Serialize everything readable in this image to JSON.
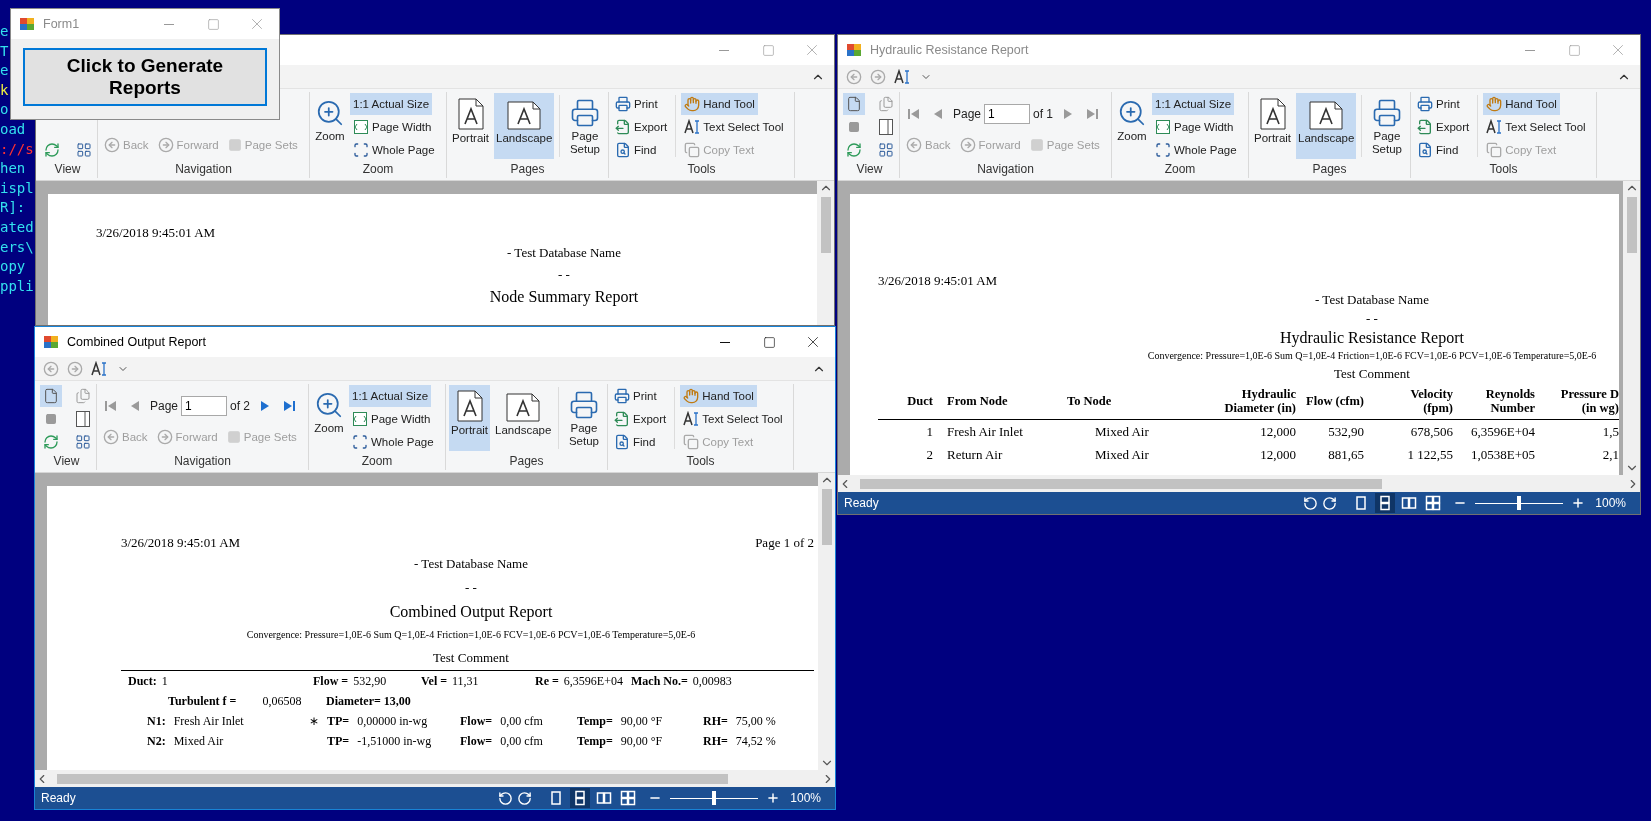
{
  "console": {
    "lines": [
      {
        "text": "e",
        "color": "#33e0ee"
      },
      {
        "text": "T",
        "color": "#33e0ee"
      },
      {
        "text": "e",
        "color": "#33e0ee"
      },
      {
        "text": "k",
        "color": "#f0f040"
      },
      {
        "text": "o",
        "color": "#33e0ee"
      },
      {
        "text": "oad",
        "color": "#33e0ee"
      },
      {
        "text": "://s",
        "color": "#ff3030"
      },
      {
        "text": "hen",
        "color": "#33e0ee"
      },
      {
        "text": "ispl",
        "color": "#33e0ee"
      },
      {
        "text": "R]:",
        "color": "#33e0ee"
      },
      {
        "text": "ated",
        "color": "#33e0ee"
      },
      {
        "text": "ers\\",
        "color": "#33e0ee"
      },
      {
        "text": "opy",
        "color": "#33e0ee"
      },
      {
        "text": "ppli",
        "color": "#33e0ee"
      }
    ]
  },
  "form1": {
    "title": "Form1",
    "active": false,
    "button": "Click to Generate Reports"
  },
  "report_windows": [
    {
      "active": false,
      "ribbon": {
        "groups": [
          {
            "kind": "view",
            "label": "View"
          },
          {
            "kind": "navigation",
            "label": "Navigation",
            "history": [
              {
                "label": "Back",
                "disabled": true
              },
              {
                "label": "Forward",
                "disabled": true
              },
              {
                "label": "Page Sets",
                "disabled": true
              }
            ]
          },
          {
            "kind": "zoom",
            "label": "Zoom",
            "button": "Zoom",
            "options": [
              {
                "label": "1:1 Actual Size",
                "selected": true
              },
              {
                "label": "Page Width",
                "selected": false
              },
              {
                "label": "Whole Page",
                "selected": false
              }
            ]
          },
          {
            "kind": "pages",
            "label": "Pages",
            "orientations": [
              {
                "label": "Portrait",
                "selected": false
              },
              {
                "label": "Landscape",
                "selected": true
              }
            ],
            "setup": "Page Setup"
          },
          {
            "kind": "tools",
            "label": "Tools",
            "actions": [
              {
                "label": "Print"
              },
              {
                "label": "Export"
              },
              {
                "label": "Find"
              }
            ],
            "tools": [
              {
                "label": "Hand Tool",
                "selected": true,
                "disabled": false
              },
              {
                "label": "Text Select Tool",
                "selected": false,
                "disabled": false
              },
              {
                "label": "Copy Text",
                "selected": false,
                "disabled": true
              }
            ]
          }
        ]
      },
      "document": {
        "date": "3/26/2018 9:45:01 AM",
        "lines": [
          {
            "kind": "subtitle",
            "text": "- Test Database Name"
          },
          {
            "kind": "subtitle",
            "text": "- -"
          },
          {
            "kind": "title",
            "text": "Node Summary Report"
          }
        ]
      }
    },
    {
      "active": false,
      "title": "Hydraulic Resistance Report",
      "quick_access": {
        "back_enabled": false,
        "forward_enabled": false
      },
      "ribbon": {
        "groups": [
          {
            "kind": "view",
            "label": "View",
            "single_page_selected": true
          },
          {
            "kind": "navigation",
            "label": "Navigation",
            "page_nav": {
              "label": "Page",
              "value": "1",
              "total": "of 1",
              "first_enabled": false,
              "prev_enabled": false,
              "next_enabled": false,
              "last_enabled": false
            },
            "history": [
              {
                "label": "Back",
                "disabled": true
              },
              {
                "label": "Forward",
                "disabled": true
              },
              {
                "label": "Page Sets",
                "disabled": true
              }
            ]
          },
          {
            "kind": "zoom",
            "label": "Zoom",
            "button": "Zoom",
            "options": [
              {
                "label": "1:1 Actual Size",
                "selected": true
              },
              {
                "label": "Page Width",
                "selected": false
              },
              {
                "label": "Whole Page",
                "selected": false
              }
            ]
          },
          {
            "kind": "pages",
            "label": "Pages",
            "orientations": [
              {
                "label": "Portrait",
                "selected": false
              },
              {
                "label": "Landscape",
                "selected": true
              }
            ],
            "setup": "Page Setup"
          },
          {
            "kind": "tools",
            "label": "Tools",
            "actions": [
              {
                "label": "Print"
              },
              {
                "label": "Export"
              },
              {
                "label": "Find"
              }
            ],
            "tools": [
              {
                "label": "Hand Tool",
                "selected": true,
                "disabled": false
              },
              {
                "label": "Text Select Tool",
                "selected": false,
                "disabled": false
              },
              {
                "label": "Copy Text",
                "selected": false,
                "disabled": true
              }
            ]
          }
        ]
      },
      "document": {
        "date": "3/26/2018 9:45:01 AM",
        "lines": [
          {
            "kind": "subtitle",
            "text": "- Test Database Name"
          },
          {
            "kind": "subtitle",
            "text": "- -"
          },
          {
            "kind": "title",
            "text": "Hydraulic Resistance Report"
          },
          {
            "kind": "note",
            "text": "Convergence: Pressure=1,0E-6 Sum Q=1,0E-4 Friction=1,0E-6 FCV=1,0E-6 PCV=1,0E-6 Temperature=5,0E-6"
          },
          {
            "kind": "subtitle",
            "text": "Test Comment"
          }
        ],
        "table": {
          "columns": [
            "Duct",
            "From Node",
            "To Node",
            "Hydraulic Diameter (in)",
            "Flow (cfm)",
            "Velocity (fpm)",
            "Reynolds Number",
            "Pressure D (in wg)"
          ],
          "rows": [
            [
              "1",
              "Fresh Air Inlet",
              "Mixed Air",
              "12,000",
              "532,90",
              "678,506",
              "6,3596E+04",
              "1,5"
            ],
            [
              "2",
              "Return Air",
              "Mixed Air",
              "12,000",
              "881,65",
              "1 122,55",
              "1,0538E+05",
              "2,1"
            ]
          ]
        }
      },
      "status": {
        "text": "Ready",
        "view_modes": [
          {
            "selected": false
          },
          {
            "selected": true
          },
          {
            "selected": false
          },
          {
            "selected": false
          }
        ],
        "zoom": {
          "level": 0.5,
          "reading": "100%"
        }
      }
    },
    {
      "active": true,
      "title": "Combined Output Report",
      "quick_access": {
        "back_enabled": false,
        "forward_enabled": false
      },
      "ribbon": {
        "groups": [
          {
            "kind": "view",
            "label": "View",
            "single_page_selected": true
          },
          {
            "kind": "navigation",
            "label": "Navigation",
            "page_nav": {
              "label": "Page",
              "value": "1",
              "total": "of 2",
              "first_enabled": false,
              "prev_enabled": false,
              "next_enabled": true,
              "last_enabled": true
            },
            "history": [
              {
                "label": "Back",
                "disabled": true
              },
              {
                "label": "Forward",
                "disabled": true
              },
              {
                "label": "Page Sets",
                "disabled": true
              }
            ]
          },
          {
            "kind": "zoom",
            "label": "Zoom",
            "button": "Zoom",
            "options": [
              {
                "label": "1:1 Actual Size",
                "selected": true
              },
              {
                "label": "Page Width",
                "selected": false
              },
              {
                "label": "Whole Page",
                "selected": false
              }
            ]
          },
          {
            "kind": "pages",
            "label": "Pages",
            "orientations": [
              {
                "label": "Portrait",
                "selected": true
              },
              {
                "label": "Landscape",
                "selected": false
              }
            ],
            "setup": "Page Setup"
          },
          {
            "kind": "tools",
            "label": "Tools",
            "actions": [
              {
                "label": "Print"
              },
              {
                "label": "Export"
              },
              {
                "label": "Find"
              }
            ],
            "tools": [
              {
                "label": "Hand Tool",
                "selected": true,
                "disabled": false
              },
              {
                "label": "Text Select Tool",
                "selected": false,
                "disabled": false
              },
              {
                "label": "Copy Text",
                "selected": false,
                "disabled": true
              }
            ]
          }
        ]
      },
      "document": {
        "date": "3/26/2018 9:45:01 AM",
        "page_label": "Page 1 of 2",
        "lines": [
          {
            "kind": "subtitle",
            "text": "- Test Database Name"
          },
          {
            "kind": "subtitle",
            "text": "- -"
          },
          {
            "kind": "title",
            "text": "Combined Output Report"
          },
          {
            "kind": "note",
            "text": "Convergence: Pressure=1,0E-6 Sum Q=1,0E-4 Friction=1,0E-6 FCV=1,0E-6 PCV=1,0E-6 Temperature=5,0E-6"
          },
          {
            "kind": "subtitle",
            "text": "Test Comment"
          }
        ],
        "details": [
          {
            "kind": "duct",
            "cells": [
              {
                "label": "Duct:",
                "value": "1"
              },
              {
                "label": "Flow =",
                "value": "532,90"
              },
              {
                "label": "Vel =",
                "value": "11,31"
              },
              {
                "label": "Re =",
                "value": "6,3596E+04"
              },
              {
                "label": "Mach No.=",
                "value": "0,00983"
              }
            ]
          },
          {
            "kind": "friction",
            "cells": [
              {
                "label": "Turbulent f =",
                "value": "0,06508"
              },
              {
                "label": "Diameter= 13,00"
              }
            ]
          },
          {
            "kind": "node",
            "cells": [
              {
                "label": "N1:",
                "value": "Fresh Air Inlet"
              },
              {
                "mark": "∗",
                "label": "TP=",
                "value": "0,00000 in-wg"
              },
              {
                "label": "Flow=",
                "value": "0,00 cfm"
              },
              {
                "label": "Temp=",
                "value": "90,00 °F"
              },
              {
                "label": "RH=",
                "value": "75,00 %"
              }
            ]
          },
          {
            "kind": "node",
            "cells": [
              {
                "label": "N2:",
                "value": "Mixed Air"
              },
              {
                "label": "TP=",
                "value": "-1,51000 in-wg"
              },
              {
                "label": "Flow=",
                "value": "0,00 cfm"
              },
              {
                "label": "Temp=",
                "value": "90,00 °F"
              },
              {
                "label": "RH=",
                "value": "74,52 %"
              }
            ]
          }
        ]
      },
      "status": {
        "text": "Ready",
        "view_modes": [
          {
            "selected": false
          },
          {
            "selected": true
          },
          {
            "selected": false
          },
          {
            "selected": false
          }
        ],
        "zoom": {
          "level": 0.5,
          "reading": "100%"
        }
      }
    }
  ]
}
